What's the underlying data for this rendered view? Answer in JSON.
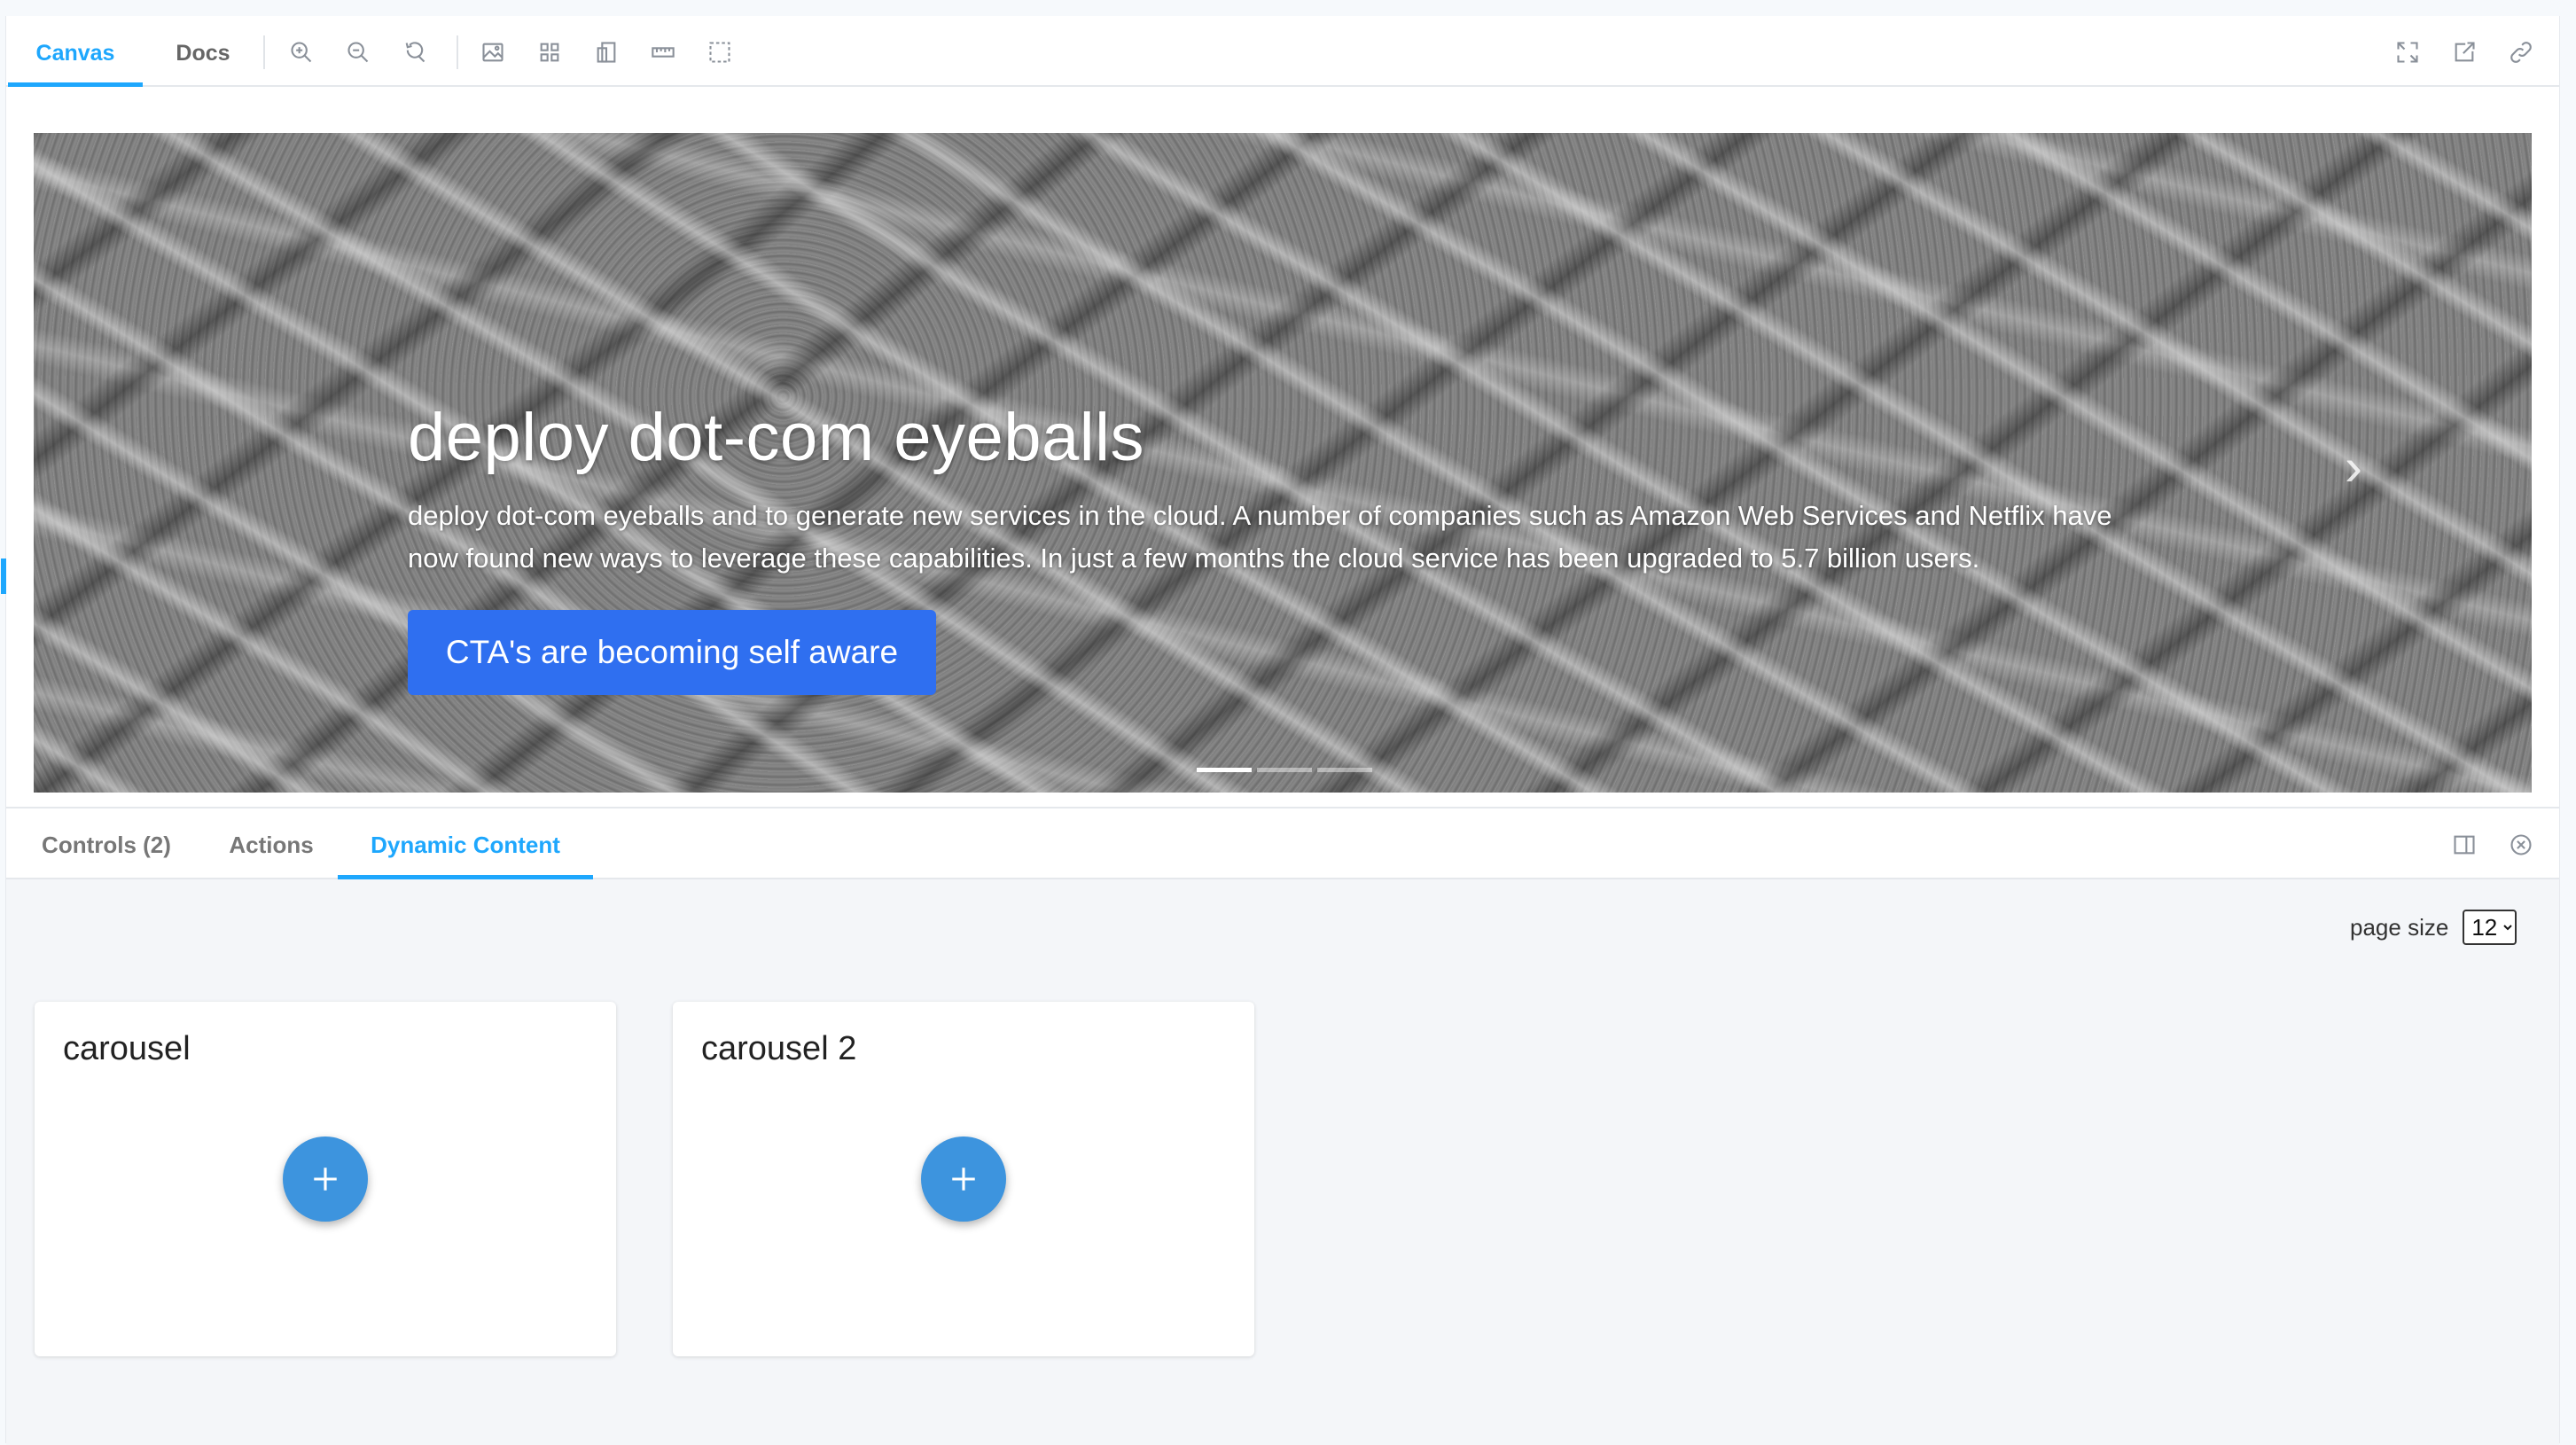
{
  "toolbar": {
    "tabs": [
      {
        "label": "Canvas",
        "active": true
      },
      {
        "label": "Docs",
        "active": false
      }
    ],
    "tools": [
      "zoom-in-icon",
      "zoom-out-icon",
      "reset-zoom-icon",
      "background-icon",
      "grid-icon",
      "viewport-icon",
      "measure-icon",
      "outline-icon"
    ],
    "right_tools": [
      "fullscreen-icon",
      "open-new-tab-icon",
      "copy-link-icon"
    ]
  },
  "hero": {
    "title": "deploy dot-com eyeballs",
    "description": "deploy dot-com eyeballs and to generate new services in the cloud. A number of companies such as Amazon Web Services and Netflix have now found new ways to leverage these capabilities. In just a few months the cloud service has been upgraded to 5.7 billion users.",
    "cta_label": "CTA's are becoming self aware",
    "next_glyph": "›",
    "slides": 3,
    "active_slide": 0
  },
  "addons": {
    "tabs": [
      {
        "label": "Controls (2)",
        "active": false
      },
      {
        "label": "Actions",
        "active": false
      },
      {
        "label": "Dynamic Content",
        "active": true
      }
    ],
    "page_size_label": "page size",
    "page_size_value": "12",
    "cards": [
      {
        "title": "carousel"
      },
      {
        "title": "carousel 2"
      }
    ]
  },
  "colors": {
    "accent": "#1ea7fd",
    "cta": "#2f6ff0",
    "add_button": "#3d94de"
  }
}
